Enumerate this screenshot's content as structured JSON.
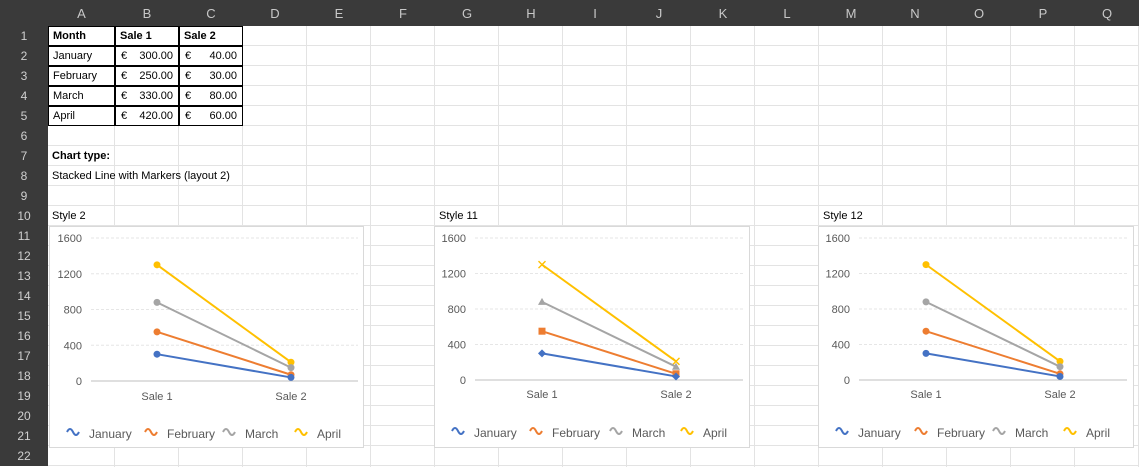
{
  "columns": [
    "A",
    "B",
    "C",
    "D",
    "E",
    "F",
    "G",
    "H",
    "I",
    "J",
    "K",
    "L",
    "M",
    "N",
    "O",
    "P",
    "Q"
  ],
  "rows": [
    "1",
    "2",
    "3",
    "4",
    "5",
    "6",
    "7",
    "8",
    "9",
    "10",
    "11",
    "12",
    "13",
    "14",
    "15",
    "16",
    "17",
    "18",
    "19",
    "20",
    "21",
    "22"
  ],
  "table": {
    "headers": [
      "Month",
      "Sale 1",
      "Sale 2"
    ],
    "currency": "€",
    "rows": [
      {
        "month": "January",
        "sale1": "300.00",
        "sale2": "40.00"
      },
      {
        "month": "February",
        "sale1": "250.00",
        "sale2": "30.00"
      },
      {
        "month": "March",
        "sale1": "330.00",
        "sale2": "80.00"
      },
      {
        "month": "April",
        "sale1": "420.00",
        "sale2": "60.00"
      }
    ]
  },
  "notes": {
    "chart_type_label": "Chart type:",
    "chart_type_value": "Stacked Line with Markers (layout 2)"
  },
  "chart_labels": [
    "Style 2",
    "Style 11",
    "Style 12"
  ],
  "colors": {
    "January": "#4472c4",
    "February": "#ed7d31",
    "March": "#a5a5a5",
    "April": "#ffc000"
  },
  "chart_data": [
    {
      "type": "line",
      "stacked": true,
      "title": "",
      "categories": [
        "Sale 1",
        "Sale 2"
      ],
      "yticks": [
        "0",
        "400",
        "800",
        "1200",
        "1600"
      ],
      "ylim": [
        0,
        1600
      ],
      "grid": true,
      "legend_position": "bottom",
      "series": [
        {
          "name": "January",
          "values": [
            300,
            40
          ]
        },
        {
          "name": "February",
          "values": [
            250,
            30
          ]
        },
        {
          "name": "March",
          "values": [
            330,
            80
          ]
        },
        {
          "name": "April",
          "values": [
            420,
            60
          ]
        }
      ],
      "markers": [
        "circle",
        "circle",
        "circle",
        "circle"
      ]
    },
    {
      "type": "line",
      "stacked": true,
      "title": "",
      "categories": [
        "Sale 1",
        "Sale 2"
      ],
      "yticks": [
        "0",
        "400",
        "800",
        "1200",
        "1600"
      ],
      "ylim": [
        0,
        1600
      ],
      "grid": true,
      "legend_position": "bottom",
      "series": [
        {
          "name": "January",
          "values": [
            300,
            40
          ]
        },
        {
          "name": "February",
          "values": [
            250,
            30
          ]
        },
        {
          "name": "March",
          "values": [
            330,
            80
          ]
        },
        {
          "name": "April",
          "values": [
            420,
            60
          ]
        }
      ],
      "markers": [
        "diamond",
        "square",
        "triangle",
        "x"
      ]
    },
    {
      "type": "line",
      "stacked": true,
      "title": "",
      "categories": [
        "Sale 1",
        "Sale 2"
      ],
      "yticks": [
        "0",
        "400",
        "800",
        "1200",
        "1600"
      ],
      "ylim": [
        0,
        1600
      ],
      "grid": true,
      "legend_position": "bottom",
      "series": [
        {
          "name": "January",
          "values": [
            300,
            40
          ]
        },
        {
          "name": "February",
          "values": [
            250,
            30
          ]
        },
        {
          "name": "March",
          "values": [
            330,
            80
          ]
        },
        {
          "name": "April",
          "values": [
            420,
            60
          ]
        }
      ],
      "markers": [
        "circle",
        "circle",
        "circle",
        "circle"
      ]
    }
  ]
}
